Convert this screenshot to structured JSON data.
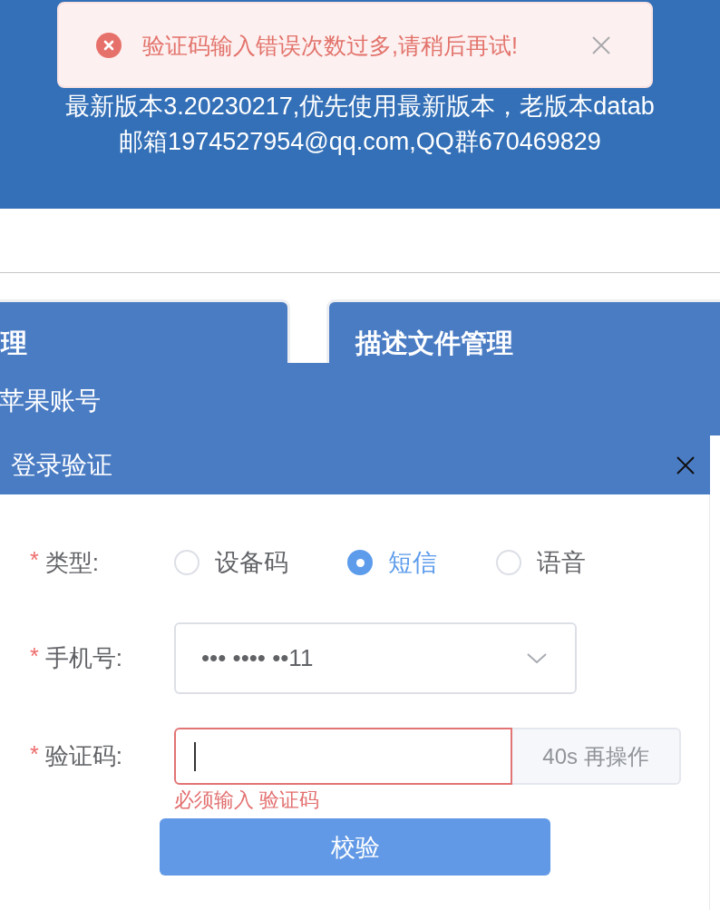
{
  "toast": {
    "kind": "error",
    "message": "验证码输入错误次数过多,请稍后再试!"
  },
  "banner": {
    "lines": [
      "最新版本3.20230217,优先使用最新版本，老版本datab",
      "邮箱1974527954@qq.com,QQ群670469829"
    ]
  },
  "tabs": [
    {
      "label": "理"
    },
    {
      "label": "描述文件管理"
    }
  ],
  "section": {
    "title": "苹果账号"
  },
  "dialog": {
    "title": "登录验证",
    "fields": [
      {
        "kind": "radio",
        "required_mark": "*",
        "label": "类型:",
        "options": [
          {
            "label": "设备码",
            "selected": false
          },
          {
            "label": "短信",
            "selected": true
          },
          {
            "label": "语音",
            "selected": false
          }
        ]
      },
      {
        "kind": "select",
        "required_mark": "*",
        "label": "手机号:",
        "value": "••• •••• ••11"
      },
      {
        "kind": "input",
        "required_mark": "*",
        "label": "验证码:",
        "focused": true,
        "invalid": true,
        "error": "必须输入 验证码",
        "append": "40s 再操作"
      }
    ],
    "submit": "校验"
  }
}
